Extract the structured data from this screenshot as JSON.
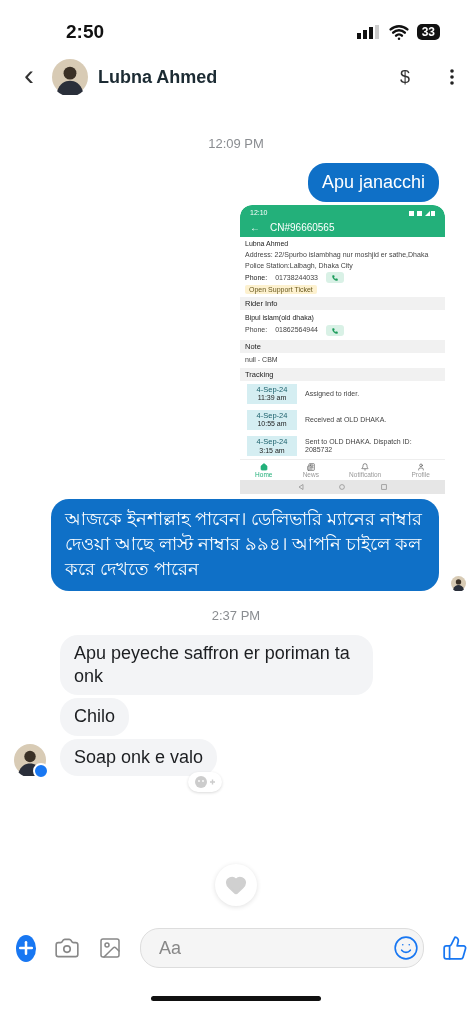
{
  "status_bar": {
    "time": "2:50",
    "battery": "33"
  },
  "header": {
    "back": "‹",
    "contact_name": "Lubna Ahmed",
    "payment_symbol": "$"
  },
  "messages": [
    {
      "kind": "timestamp",
      "text": "12:09 PM"
    },
    {
      "kind": "sent_text",
      "text": "Apu janacchi",
      "read_receipt": false
    },
    {
      "kind": "sent_screenshot",
      "screenshot": {
        "status_time": "12:10",
        "back_arrow": "←",
        "title": "CN#96660565",
        "customer": {
          "name": "Lubna Ahmed",
          "address": "Address: 22/Spurbo islambhag nur moshjid er sathe,Dhaka",
          "police_station": "Police Station:Lalbagh, Dhaka City",
          "phone_label": "Phone:",
          "phone": "01738244033"
        },
        "support_button": "Open Support Ticket",
        "rider": {
          "heading": "Rider Info",
          "name": "Bipul islam(old dhaka)",
          "phone_label": "Phone:",
          "phone": "01862564944"
        },
        "note": {
          "heading": "Note",
          "text": "null - CBM"
        },
        "tracking": {
          "heading": "Tracking",
          "events": [
            {
              "date": "4-Sep-24",
              "time": "11:39 am",
              "text": "Assigned to rider."
            },
            {
              "date": "4-Sep-24",
              "time": "10:55 am",
              "text": "Received at OLD DHAKA."
            },
            {
              "date": "4-Sep-24",
              "time": "3:15 am",
              "text": "Sent to OLD DHAKA. Dispatch ID: 2085732"
            }
          ]
        },
        "nav": [
          {
            "kind": "home",
            "label": "Home",
            "selected": true
          },
          {
            "kind": "news",
            "label": "News",
            "selected": false
          },
          {
            "kind": "notification",
            "label": "Notification",
            "selected": false
          },
          {
            "kind": "profile",
            "label": "Profile",
            "selected": false
          }
        ]
      }
    },
    {
      "kind": "sent_text",
      "text": "আজকে ইনশাল্লাহ পাবেন। ডেলিভারি ম্যানের নাম্বার দেওয়া আছে লাস্ট নাম্বার ৯৯৪। আপনি চাইলে কল করে দেখতে পারেন",
      "read_receipt": true
    },
    {
      "kind": "timestamp",
      "text": "2:37 PM"
    },
    {
      "kind": "received_text",
      "text": "Apu peyeche saffron er poriman ta onk",
      "avatar": false
    },
    {
      "kind": "received_text",
      "text": "Chilo",
      "avatar": false
    },
    {
      "kind": "received_text",
      "text": "Soap onk e valo",
      "avatar": true
    }
  ],
  "composer": {
    "placeholder": "Aa"
  }
}
